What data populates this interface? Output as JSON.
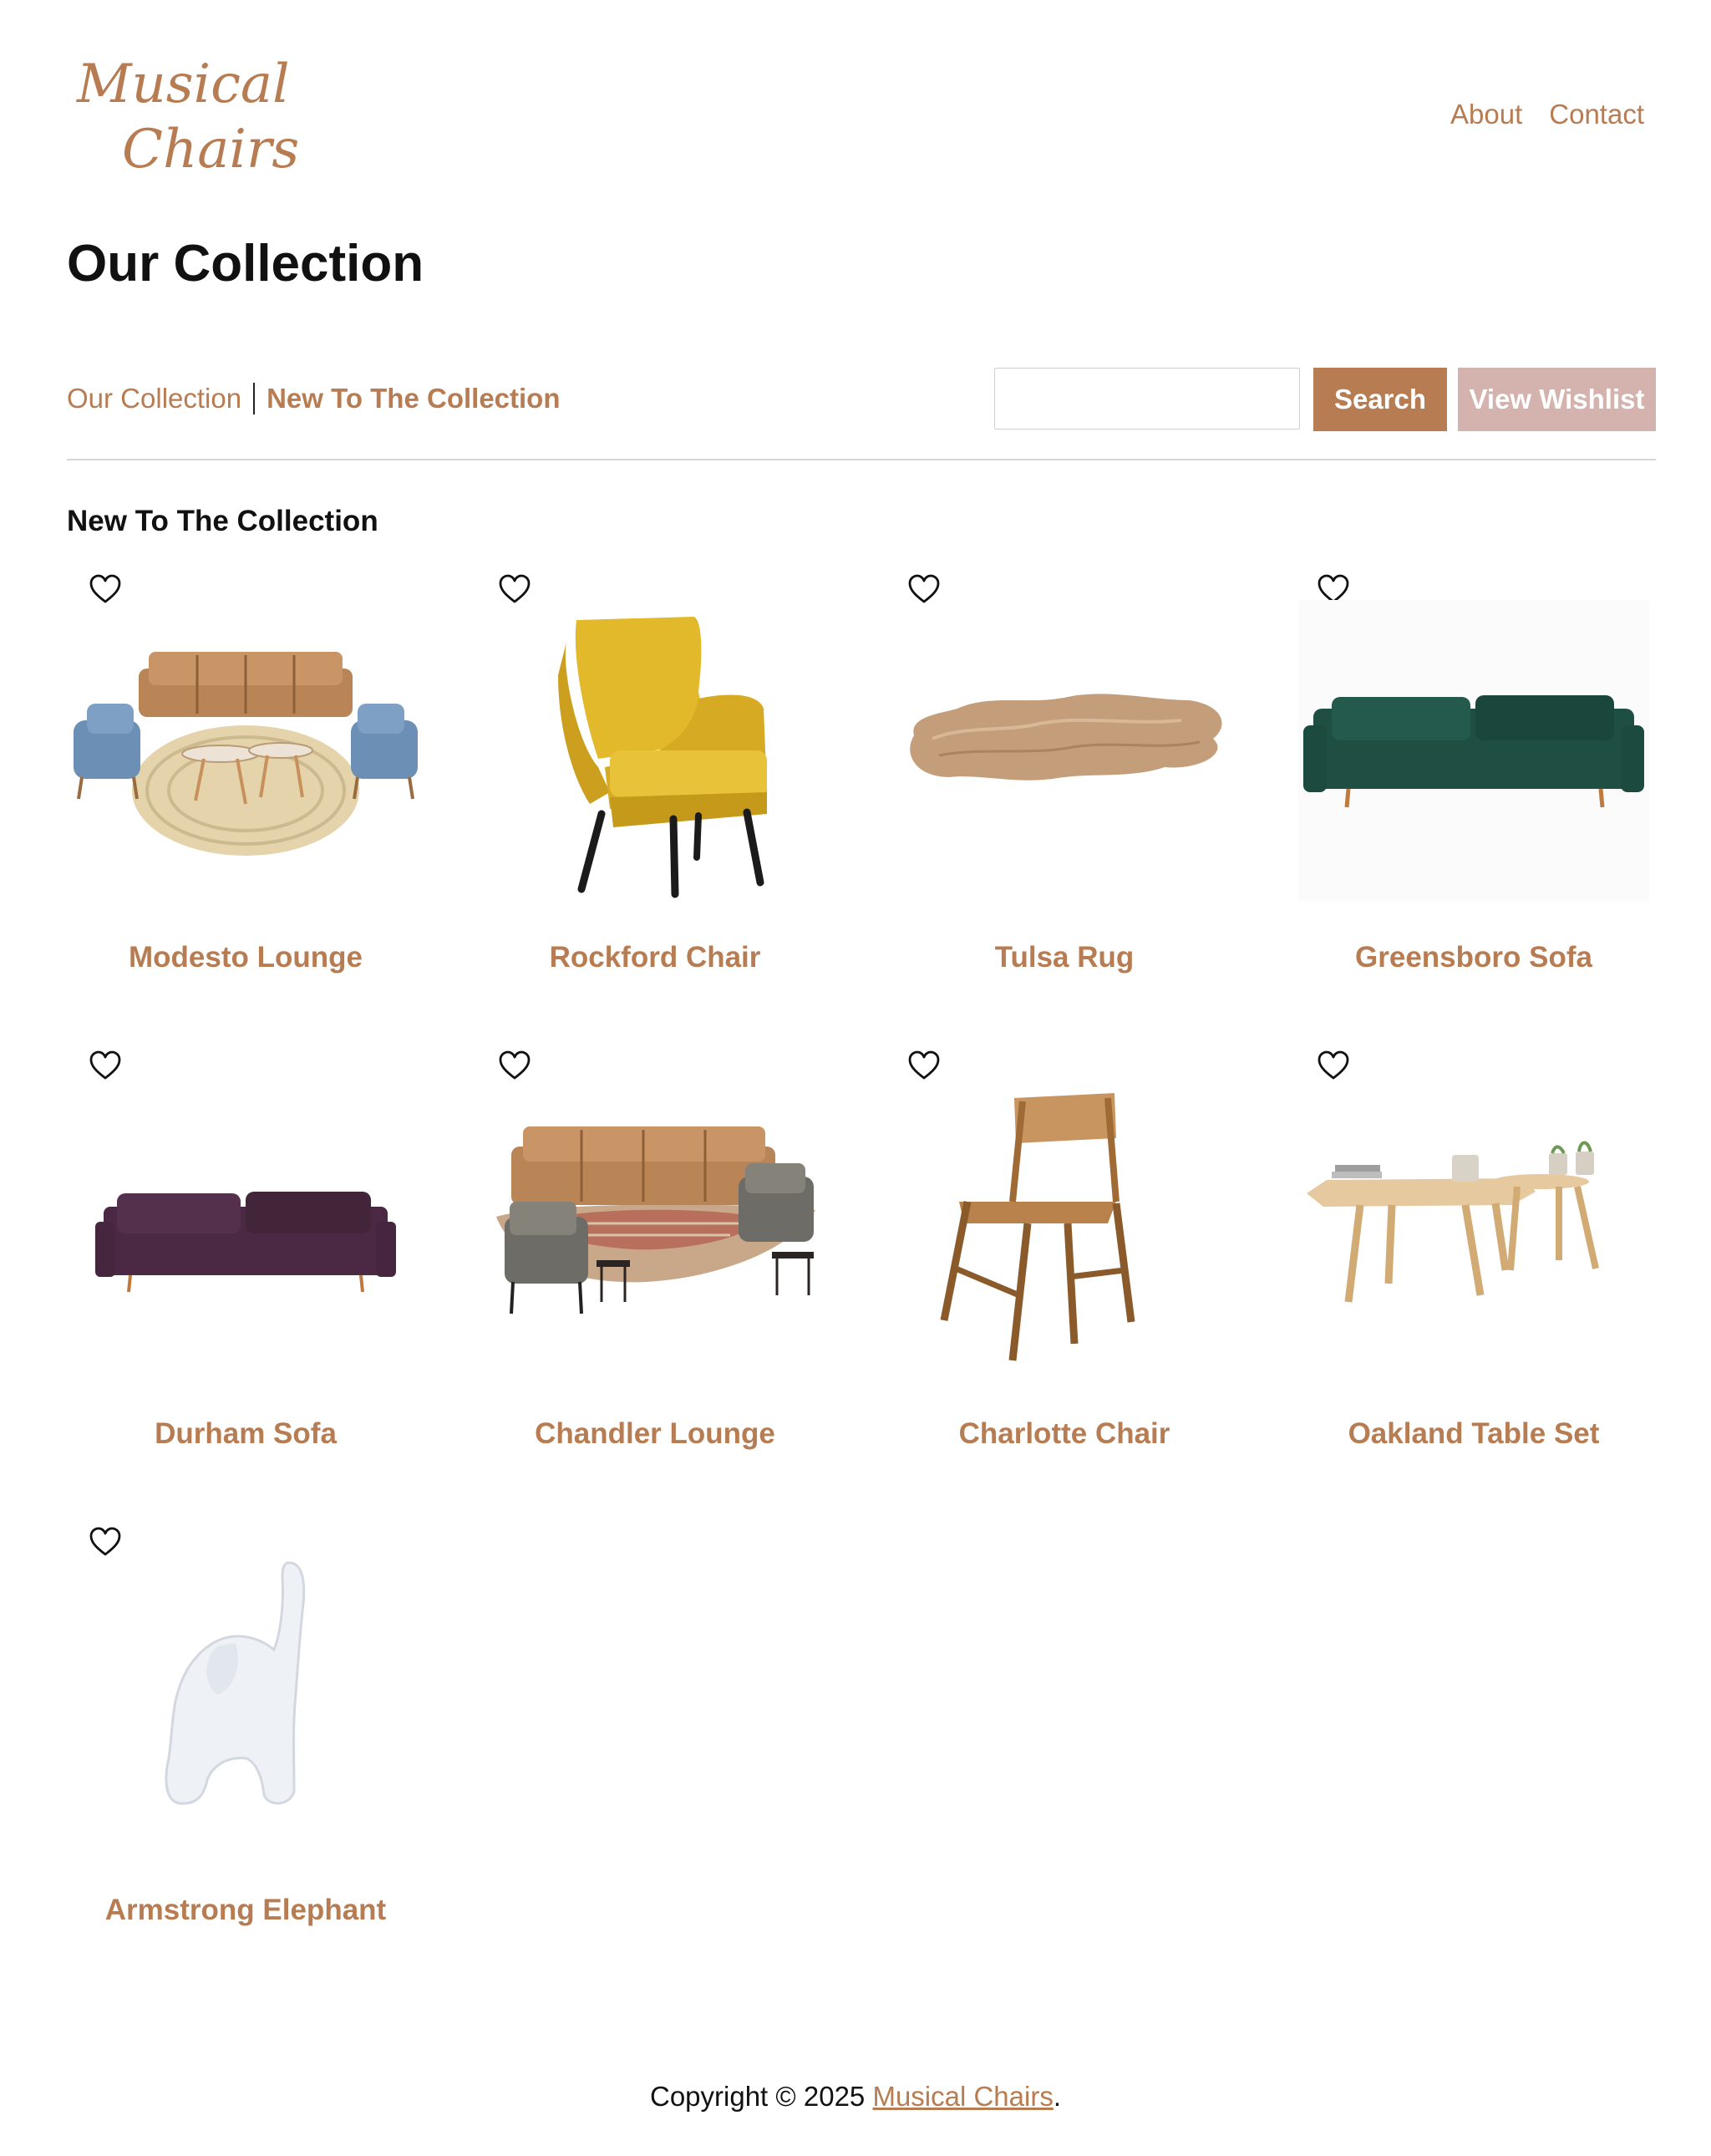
{
  "logo": {
    "line1": "Musical",
    "line2": "Chairs"
  },
  "nav": {
    "about": "About",
    "contact": "Contact"
  },
  "page": {
    "title": "Our Collection"
  },
  "filters": {
    "all": "Our Collection",
    "new": "New To The Collection"
  },
  "search": {
    "placeholder": "",
    "button": "Search"
  },
  "wishlist": {
    "button": "View Wishlist"
  },
  "section": {
    "title": "New To The Collection"
  },
  "products": [
    {
      "name": "Modesto Lounge",
      "icon": "lounge-set-image"
    },
    {
      "name": "Rockford Chair",
      "icon": "armchair-image"
    },
    {
      "name": "Tulsa Rug",
      "icon": "rug-image"
    },
    {
      "name": "Greensboro Sofa",
      "icon": "sofa-image"
    },
    {
      "name": "Durham Sofa",
      "icon": "sofa-image"
    },
    {
      "name": "Chandler Lounge",
      "icon": "lounge-set-image"
    },
    {
      "name": "Charlotte Chair",
      "icon": "wooden-chair-image"
    },
    {
      "name": "Oakland Table Set",
      "icon": "table-set-image"
    },
    {
      "name": "Armstrong Elephant",
      "icon": "elephant-figurine-image"
    }
  ],
  "footer": {
    "prefix": "Copyright © 2025 ",
    "link": "Musical Chairs",
    "suffix": "."
  },
  "colors": {
    "accent": "#b87c52",
    "wishlist": "#d4b2ae"
  }
}
